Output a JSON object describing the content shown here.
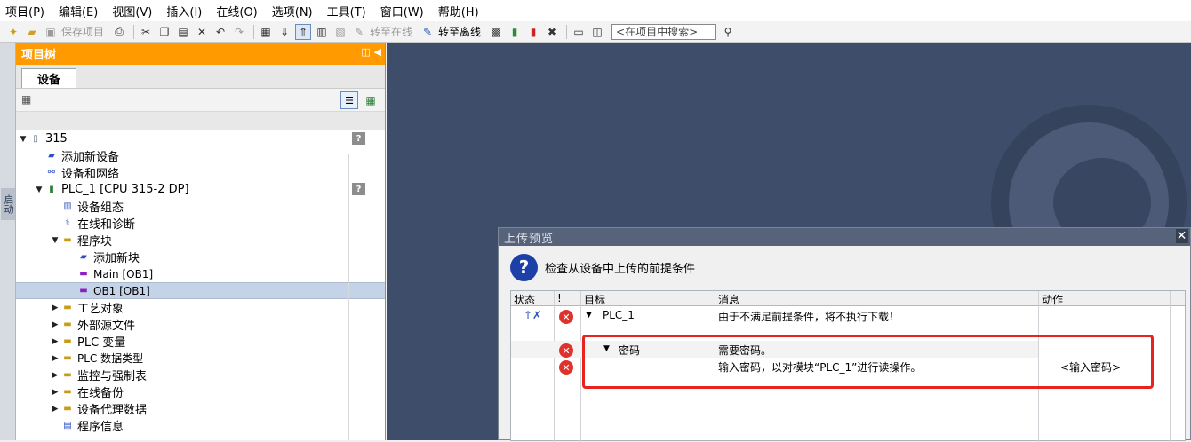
{
  "menu": [
    "项目(P)",
    "编辑(E)",
    "视图(V)",
    "插入(I)",
    "在线(O)",
    "选项(N)",
    "工具(T)",
    "窗口(W)",
    "帮助(H)"
  ],
  "toolbar": {
    "save_project": "保存项目",
    "go_online": "转至在线",
    "go_offline": "转至离线",
    "search_placeholder": "<在项目中搜索>"
  },
  "side_strip": {
    "label": "启动"
  },
  "project_tree": {
    "title": "项目树",
    "tab": "设备",
    "items": [
      {
        "label": "315",
        "level": 0,
        "expand": "open",
        "help": true
      },
      {
        "label": "添加新设备",
        "level": 1
      },
      {
        "label": "设备和网络",
        "level": 1
      },
      {
        "label": "PLC_1 [CPU 315-2 DP]",
        "level": 1,
        "expand": "open",
        "help": true
      },
      {
        "label": "设备组态",
        "level": 2
      },
      {
        "label": "在线和诊断",
        "level": 2
      },
      {
        "label": "程序块",
        "level": 2,
        "expand": "open"
      },
      {
        "label": "添加新块",
        "level": 3
      },
      {
        "label": "Main [OB1]",
        "level": 3
      },
      {
        "label": "OB1 [OB1]",
        "level": 3,
        "selected": true
      },
      {
        "label": "工艺对象",
        "level": 2,
        "expand": "closed"
      },
      {
        "label": "外部源文件",
        "level": 2,
        "expand": "closed"
      },
      {
        "label": "PLC 变量",
        "level": 2,
        "expand": "closed"
      },
      {
        "label": "PLC 数据类型",
        "level": 2,
        "expand": "closed"
      },
      {
        "label": "监控与强制表",
        "level": 2,
        "expand": "closed"
      },
      {
        "label": "在线备份",
        "level": 2,
        "expand": "closed"
      },
      {
        "label": "设备代理数据",
        "level": 2,
        "expand": "closed"
      },
      {
        "label": "程序信息",
        "level": 2
      }
    ]
  },
  "upload_dialog": {
    "title": "上传预览",
    "heading": "检查从设备中上传的前提条件",
    "columns": {
      "status": "状态",
      "excl": "!",
      "target": "目标",
      "message": "消息",
      "action": "动作"
    },
    "rows": [
      {
        "target": "PLC_1",
        "message": "由于不满足前提条件，将不执行下载！",
        "action": ""
      },
      {
        "target": "密码",
        "message": "需要密码。",
        "action": ""
      },
      {
        "target": "",
        "message": "输入密码，以对模块“PLC_1”进行读操作。",
        "action": "<输入密码>"
      }
    ]
  },
  "colors": {
    "tree_header": "#ff9b00",
    "workspace": "#3e4d6a",
    "highlight_box": "#e8231f",
    "error": "#e0322c"
  }
}
